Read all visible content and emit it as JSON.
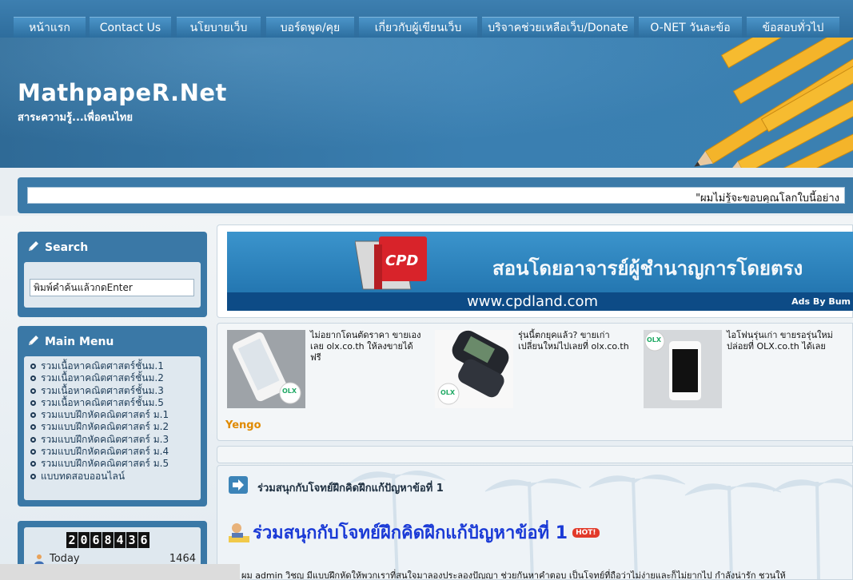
{
  "nav": {
    "items": [
      {
        "label": "หน้าแรก"
      },
      {
        "label": "Contact Us"
      },
      {
        "label": "นโยบายเว็บ"
      },
      {
        "label": "บอร์ดพูด/คุย"
      },
      {
        "label": "เกี่ยวกับผู้เขียนเว็บ"
      },
      {
        "label": "บริจาคช่วยเหลือเว็บ/Donate"
      },
      {
        "label": "O-NET วันละข้อ"
      },
      {
        "label": "ข้อสอบทั่วไป"
      }
    ]
  },
  "header": {
    "title": "MathpapeR.Net",
    "tagline": "สาระความรู้...เพื่อคนไทย"
  },
  "marquee": {
    "text": "\"ผมไม่รู้จะขอบคุณโลกใบนี้อย่าง"
  },
  "search": {
    "heading": "Search",
    "input_value": "พิมพ์คำค้นแล้วกดEnter"
  },
  "main_menu": {
    "heading": "Main Menu",
    "items": [
      "รวมเนื้อหาคณิตศาสตร์ชั้นม.1",
      "รวมเนื้อหาคณิตศาสตร์ชั้นม.2",
      "รวมเนื้อหาคณิตศาสตร์ชั้นม.3",
      "รวมเนื้อหาคณิตศาสตร์ชั้นม.5",
      "รวมแบบฝึกหัดคณิตศาสตร์ ม.1",
      "รวมแบบฝึกหัดคณิตศาสตร์ ม.2",
      "รวมแบบฝึกหัดคณิตศาสตร์ ม.3",
      "รวมแบบฝึกหัดคณิตศาสตร์ ม.4",
      "รวมแบบฝึกหัดคณิตศาสตร์ ม.5",
      "แบบทดสอบออนไลน์"
    ]
  },
  "counter": {
    "digits": [
      "2",
      "0",
      "6",
      "8",
      "4",
      "3",
      "6"
    ],
    "today_label": "Today",
    "today_value": "1464"
  },
  "ad": {
    "logo_text": "CPD",
    "slogan": "สอนโดยอาจารย์ผู้ชำนาญการโดยตรง",
    "url": "www.cpdland.com",
    "credit": "Ads By Bum"
  },
  "yengo": {
    "items": [
      {
        "text": "ไม่อยากโดนตัดราคา ขายเองเลย olx.co.th ให้ลงขายได้ฟรี"
      },
      {
        "text": "รุ่นนี้ตกยุคแล้ว? ขายเก่าเปลี่ยนใหม่ไปเลยที่ olx.co.th"
      },
      {
        "text": "ไอโฟนรุ่นเก่า ขายรอรุ่นใหม่ ปล่อยที่ OLX.co.th ได้เลย"
      }
    ],
    "brand_badge": "OLX",
    "label": "Yengo"
  },
  "article": {
    "section_title": "ร่วมสนุกกับโจทย์ฝึกคิดฝึกแก้ปัญหาข้อที่ 1",
    "title": "ร่วมสนุกกับโจทย์ฝึกคิดฝึกแก้ปัญหาข้อที่ 1",
    "badge": "HOT!",
    "body": "ผม admin วิชญ มีแบบฝึกหัดให้พวกเราที่สนใจมาลองประลองปัญญา ช่วยกันหาคำตอบ เป็นโจทย์ที่ถือว่าไม่ง่ายและก็ไม่ยากไป กำลังน่ารัก ชวนให้"
  },
  "colors": {
    "nav_bg": "#2e6d9d",
    "header_blue": "#3a7fb1",
    "sidebar_blue": "#3a78a6",
    "title_link": "#1a3ad6",
    "yengo_orange": "#e08a00",
    "pencil_yellow": "#f4b42a"
  }
}
